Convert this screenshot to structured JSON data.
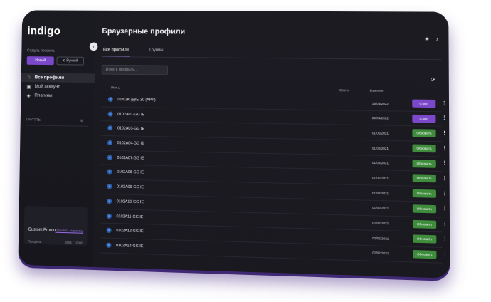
{
  "app": {
    "logo": "indigo"
  },
  "sidebar": {
    "create_label": "Создать профиль",
    "new_button": "Новый",
    "manual_button": "⟲ Ручной",
    "collapse_icon": "chevron-left-icon",
    "items": [
      {
        "label": "Все профили",
        "icon": "home-icon",
        "glyph": "⌂",
        "active": true
      },
      {
        "label": "Мой аккаунт",
        "icon": "account-icon",
        "glyph": "▣",
        "active": false
      },
      {
        "label": "Плагины",
        "icon": "layers-icon",
        "glyph": "◈",
        "active": false
      }
    ],
    "groups_label": "ГРУППЫ",
    "groups_icon": "sort-icon",
    "promo": {
      "title": "Custom Promo",
      "link": "Обновить подписку",
      "profiles_label": "Профили",
      "profiles_count": "2604 / 10000"
    }
  },
  "main": {
    "title": "Браузерные профили",
    "top_icons": [
      "sun-icon",
      "bell-icon"
    ],
    "tabs": [
      {
        "label": "Все профили",
        "active": true
      },
      {
        "label": "Группы",
        "active": false
      }
    ],
    "search_placeholder": "Искать профиль...",
    "refresh_icon": "refresh-icon",
    "columns": {
      "name": "Имя ▴",
      "status": "Статус",
      "changed": "Изменен"
    },
    "rows": [
      {
        "name": "01/02K-ggIE-30 (APP)",
        "date": "18/05/2022",
        "action": "Старт",
        "kind": "start"
      },
      {
        "name": "0102A01-GG IE",
        "date": "29/04/2022",
        "action": "Старт",
        "kind": "start"
      },
      {
        "name": "0102A03-GG IE",
        "date": "01/02/2021",
        "action": "Обновить",
        "kind": "update"
      },
      {
        "name": "0102A04-GG IE",
        "date": "01/02/2021",
        "action": "Обновить",
        "kind": "update"
      },
      {
        "name": "0102A07-GG IE",
        "date": "01/02/2021",
        "action": "Обновить",
        "kind": "update"
      },
      {
        "name": "0102A08-GG IE",
        "date": "01/02/2021",
        "action": "Обновить",
        "kind": "update"
      },
      {
        "name": "0102A09-GG IE",
        "date": "01/02/2021",
        "action": "Обновить",
        "kind": "update"
      },
      {
        "name": "0102A10-GG IE",
        "date": "01/02/2021",
        "action": "Обновить",
        "kind": "update"
      },
      {
        "name": "0102A11-GG IE",
        "date": "02/02/2021",
        "action": "Обновить",
        "kind": "update"
      },
      {
        "name": "0102A12-GG IE",
        "date": "02/02/2021",
        "action": "Обновить",
        "kind": "update"
      },
      {
        "name": "0102A14-GG IE",
        "date": "02/02/2021",
        "action": "Обновить",
        "kind": "update"
      }
    ]
  },
  "colors": {
    "accent": "#7a48c8",
    "update": "#3f8c3d",
    "background": "#17161d"
  }
}
